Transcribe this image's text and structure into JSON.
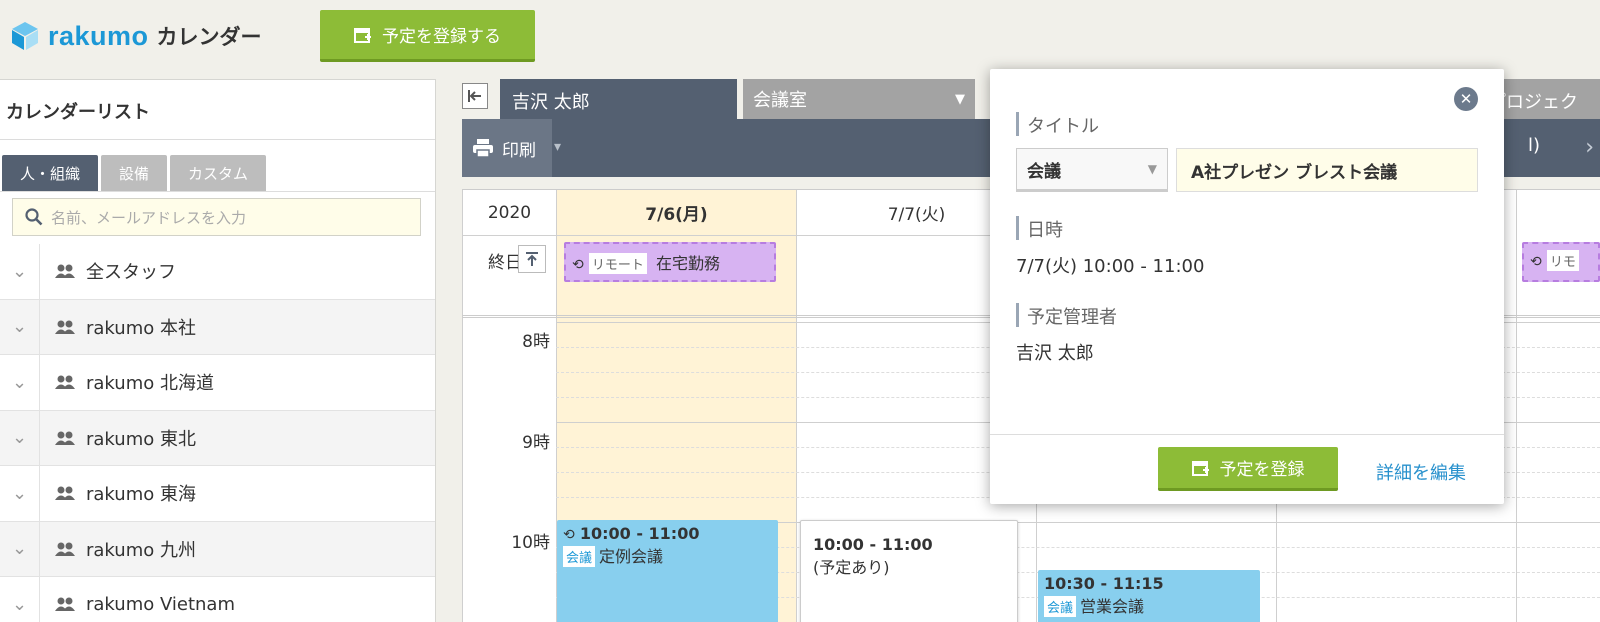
{
  "header": {
    "logo_text": "rakumo",
    "app_title": "カレンダー",
    "add_event_label": "予定を登録する"
  },
  "sidebar": {
    "title": "カレンダーリスト",
    "tabs": [
      "人・組織",
      "設備",
      "カスタム"
    ],
    "search_placeholder": "名前、メールアドレスを入力",
    "items": [
      "全スタッフ",
      "rakumo 本社",
      "rakumo 北海道",
      "rakumo 東北",
      "rakumo 東海",
      "rakumo 九州",
      "rakumo Vietnam"
    ]
  },
  "calendar": {
    "user_tab": "吉沢 太郎",
    "room_tab": "会議室",
    "project_tab": "プロジェク",
    "print_label": "印刷",
    "month_fragment": "l)",
    "year": "2020",
    "columns": [
      "7/6(月)",
      "7/7(火)"
    ],
    "allday_label": "終日",
    "hours": [
      "8時",
      "9時",
      "10時"
    ],
    "allday_event": {
      "badge": "リモート",
      "title": "在宅勤務"
    },
    "allday_event_fragment": "リモ",
    "events": [
      {
        "time": "10:00 - 11:00",
        "badge": "会議",
        "title": "定例会議"
      },
      {
        "time": "10:00 - 11:00",
        "title": "(予定あり)"
      },
      {
        "time": "10:30 - 11:15",
        "badge": "会議",
        "title": "営業会議"
      }
    ],
    "colors": {
      "today_col": "#fff3d6",
      "event_blue": "#88cfee",
      "remote_bg": "#d7b3f2",
      "remote_border": "#b77de0"
    }
  },
  "popup": {
    "title_label": "タイトル",
    "type_value": "会議",
    "title_value": "A社プレゼン ブレスト会議",
    "datetime_label": "日時",
    "datetime_value": "7/7(火) 10:00 - 11:00",
    "manager_label": "予定管理者",
    "manager_value": "吉沢 太郎",
    "register_label": "予定を登録",
    "edit_label": "詳細を編集"
  }
}
